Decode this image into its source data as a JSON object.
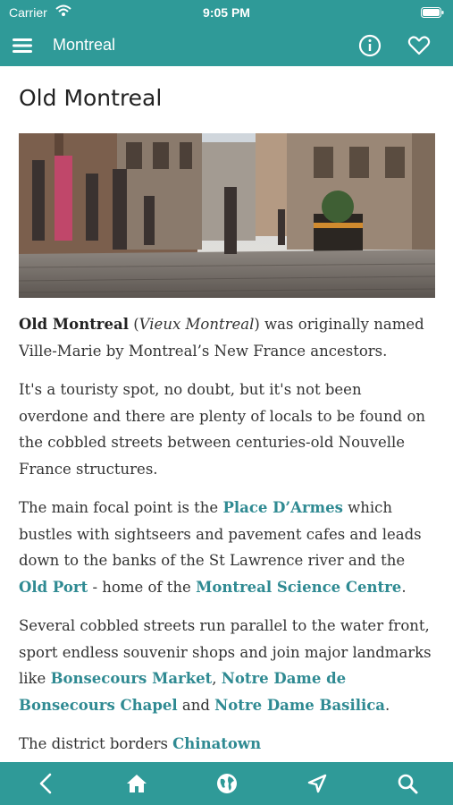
{
  "status": {
    "carrier": "Carrier",
    "time": "9:05 PM"
  },
  "navbar": {
    "title": "Montreal"
  },
  "page": {
    "title": "Old Montreal",
    "hero_icon": "street-photo"
  },
  "paragraphs": {
    "p1": {
      "bold": "Old Montreal",
      "t1": " (",
      "italic": "Vieux Montreal",
      "t2": ") was originally named Ville-Marie by Montreal’s New France ancestors."
    },
    "p2": "It's a touristy spot, no doubt, but it's not been overdone and there are plenty of locals to be found on the cobbled streets between centuries-old Nouvelle France structures.",
    "p3": {
      "t1": "The main focal point is the ",
      "link1": "Place D’Armes",
      "t2": " which bustles with sightseers and pavement cafes and leads down to the banks of the St Lawrence river and the ",
      "link2": "Old Port",
      "t3": " - home of the ",
      "link3": "Montreal Science Centre",
      "t4": "."
    },
    "p4": {
      "t1": "Several cobbled streets run parallel to the water front, sport endless souvenir shops and join major landmarks like ",
      "link1": "Bonsecours Market",
      "t2": ", ",
      "link2": "Notre Dame de Bonsecours Chapel",
      "t3": " and ",
      "link3": "Notre Dame Basilica",
      "t4": "."
    },
    "p5": {
      "t1": "The district borders ",
      "link1": "Chinatown"
    }
  },
  "colors": {
    "accent": "#2f9a98",
    "link": "#2f8a92"
  },
  "tabs": [
    "back-icon",
    "home-icon",
    "globe-icon",
    "navigate-icon",
    "search-icon"
  ]
}
